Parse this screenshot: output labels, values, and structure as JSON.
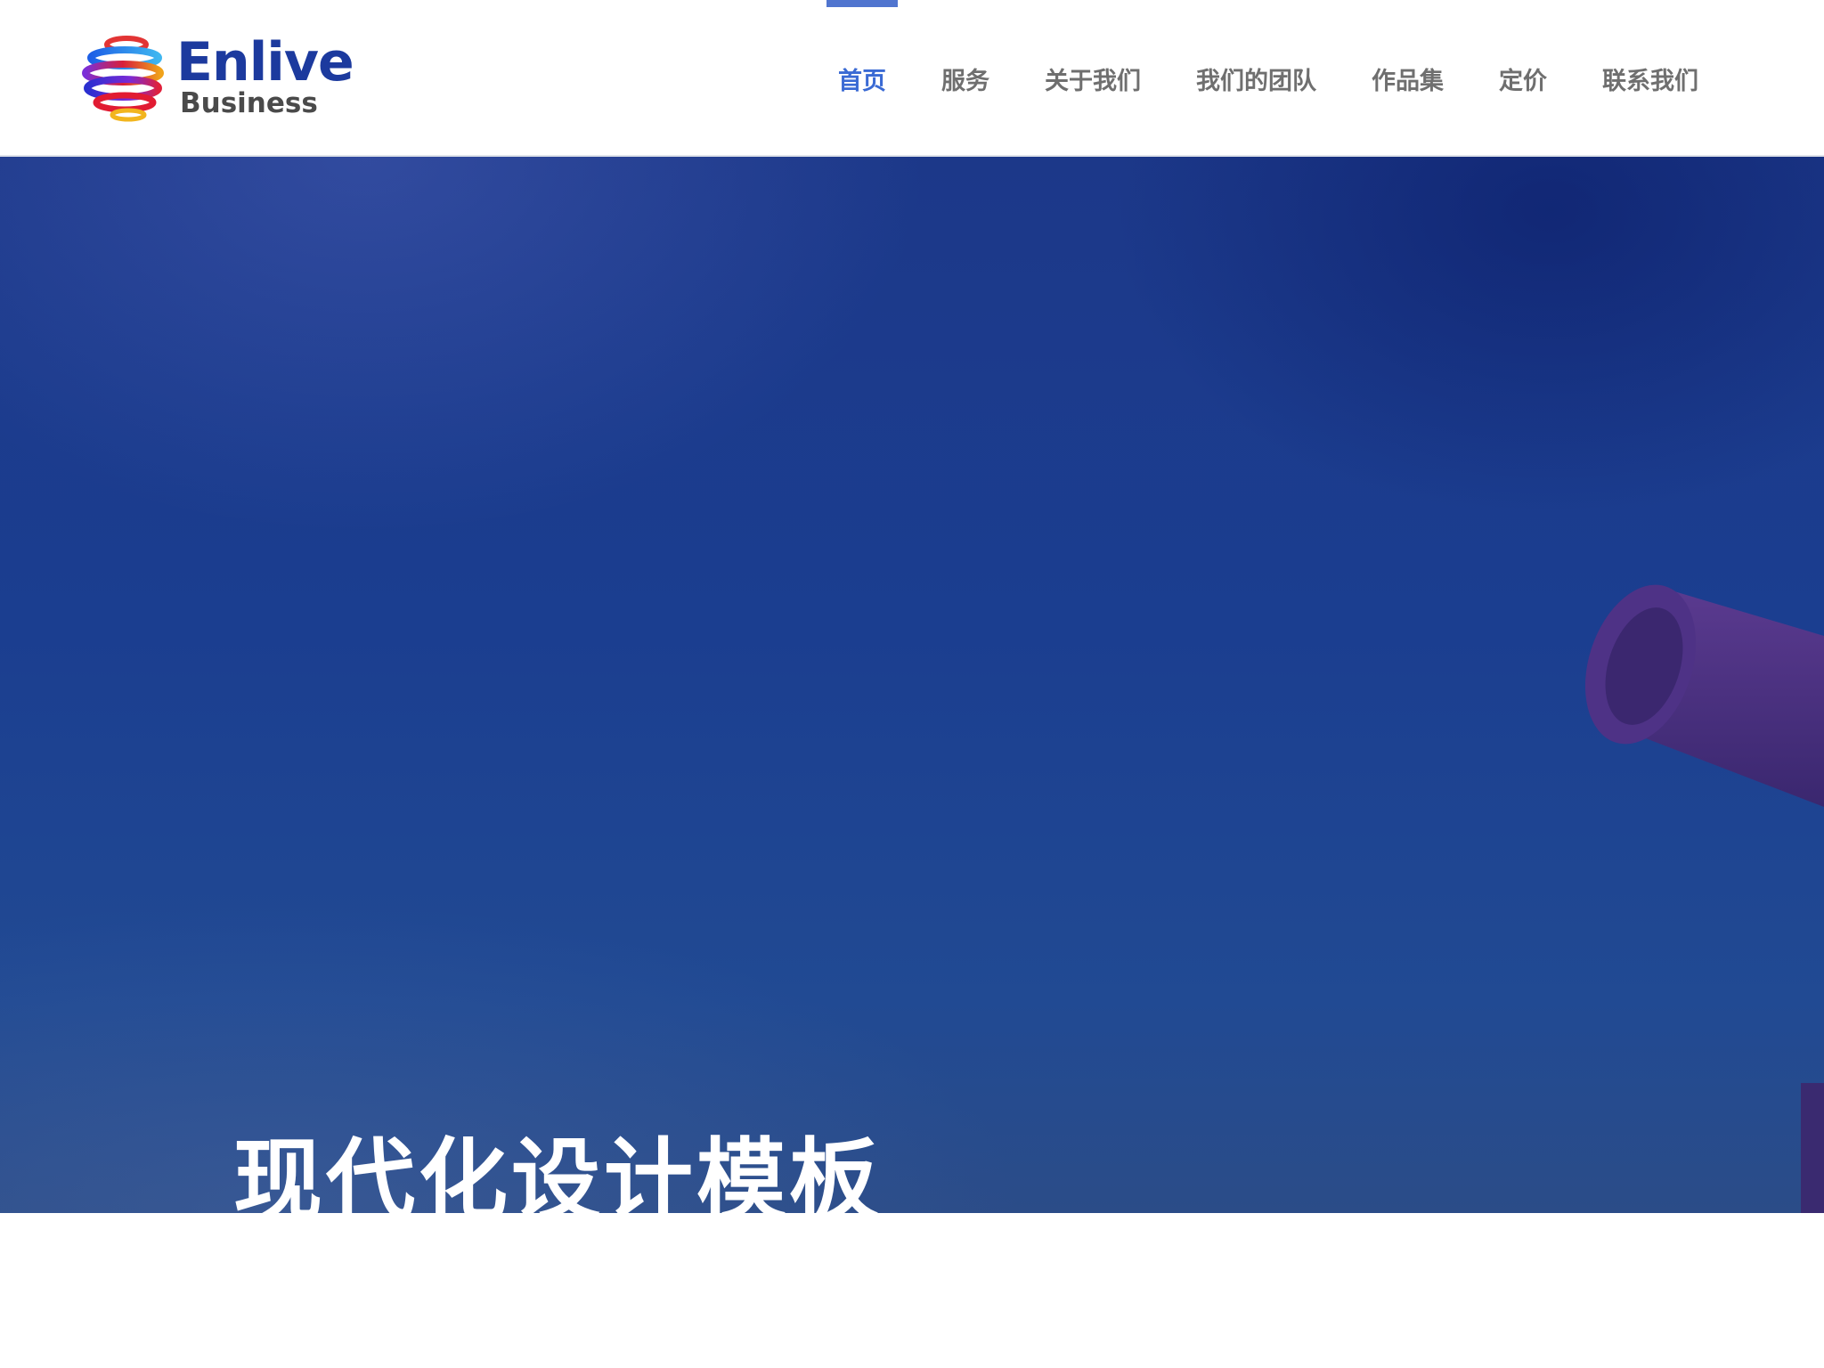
{
  "brand": {
    "name": "Enlive",
    "tagline": "Business",
    "primary_color": "#1c3a9e",
    "accent_color": "#3a6ad4"
  },
  "nav": {
    "active_index": 0,
    "items": [
      {
        "label": "首页"
      },
      {
        "label": "服务"
      },
      {
        "label": "关于我们"
      },
      {
        "label": "我们的团队"
      },
      {
        "label": "作品集"
      },
      {
        "label": "定价"
      },
      {
        "label": "联系我们"
      }
    ]
  },
  "hero": {
    "title": "现代化设计模板",
    "background_color": "#1c3a8c"
  }
}
